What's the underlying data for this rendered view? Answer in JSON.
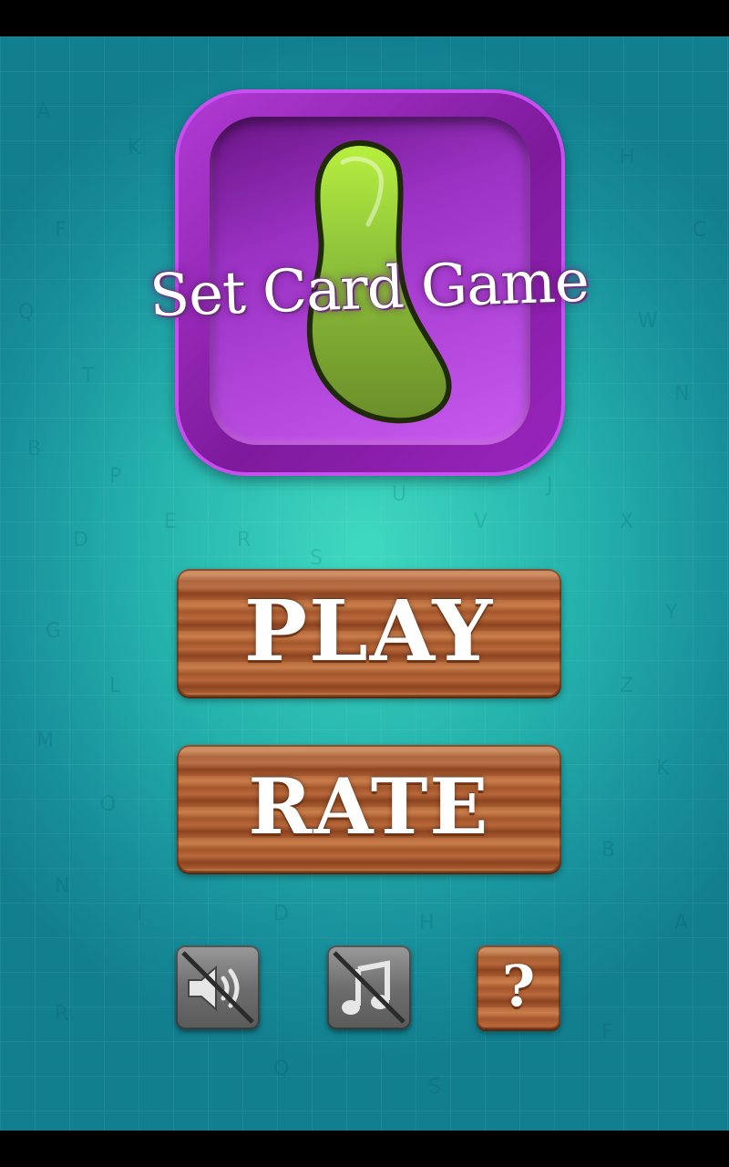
{
  "app": {
    "title": "Set Card Game"
  },
  "menu": {
    "play_label": "PLAY",
    "rate_label": "RATE"
  },
  "controls": {
    "sound_icon": "speaker-muted-icon",
    "music_icon": "music-note-muted-icon",
    "help_label": "?"
  },
  "colors": {
    "background": "#25b3ad",
    "logo_purple": "#9b25bf",
    "logo_shape_green": "#8fc43a",
    "wood": "#a65a30"
  }
}
